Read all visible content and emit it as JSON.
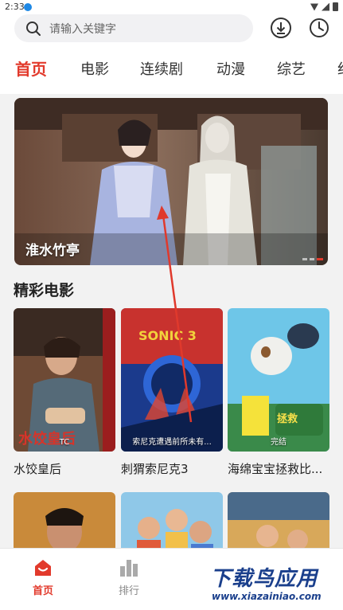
{
  "status_bar": {
    "time": "2:33"
  },
  "search": {
    "placeholder": "请输入关键字"
  },
  "tabs": [
    {
      "label": "首页",
      "active": true
    },
    {
      "label": "电影",
      "active": false
    },
    {
      "label": "连续剧",
      "active": false
    },
    {
      "label": "动漫",
      "active": false
    },
    {
      "label": "综艺",
      "active": false
    },
    {
      "label": "纪",
      "active": false
    }
  ],
  "banner": {
    "caption": "淮水竹亭"
  },
  "section": {
    "title": "精彩电影"
  },
  "movies": [
    {
      "title": "水饺皇后",
      "badge": "TC"
    },
    {
      "title": "刺猬索尼克3",
      "badge": "索尼克遭遇前所未有..."
    },
    {
      "title": "海绵宝宝拯救比...",
      "badge": "完结"
    },
    {
      "title": "",
      "badge": ""
    },
    {
      "title": "",
      "badge": ""
    },
    {
      "title": "",
      "badge": ""
    }
  ],
  "bottom_nav": [
    {
      "label": "首页",
      "icon": "home-icon",
      "active": true
    },
    {
      "label": "排行",
      "icon": "chart-icon",
      "active": false
    }
  ],
  "watermark": {
    "line1": "下载鸟应用",
    "line2": "www.xiazainiao.com"
  },
  "colors": {
    "accent": "#e23a2c",
    "watermark": "#1a3f8c"
  }
}
